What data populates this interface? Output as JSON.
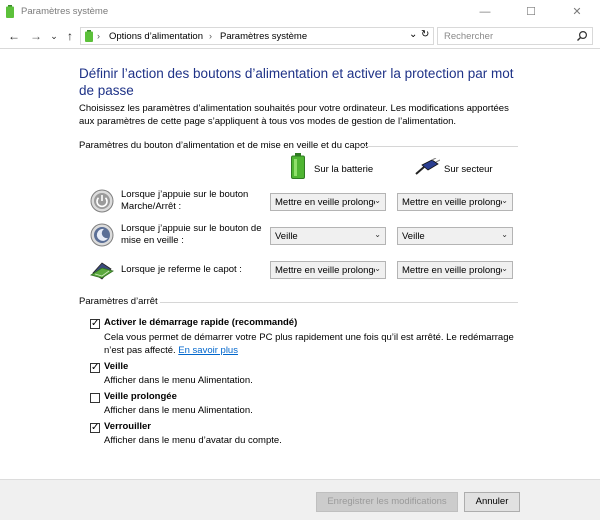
{
  "window": {
    "title": "Paramètres système",
    "minimize": "—",
    "maximize": "☐",
    "close": "✕"
  },
  "nav": {
    "back": "←",
    "forward": "→",
    "dropdown": "⌄",
    "up": "↑",
    "breadcrumbs": [
      "Options d’alimentation",
      "Paramètres système"
    ],
    "breadcrumb_sep": "›",
    "address_dropdown": "⌄",
    "refresh": "↻"
  },
  "search": {
    "placeholder": "Rechercher"
  },
  "page": {
    "heading": "Définir l’action des boutons d’alimentation et activer la protection par mot de passe",
    "intro": "Choisissez les paramètres d’alimentation souhaités pour votre ordinateur. Les modifications apportées aux paramètres de cette page s’appliquent à tous vos modes de gestion de l’alimentation."
  },
  "power_buttons": {
    "group_label": "Paramètres du bouton d’alimentation et de mise en veille et du capot",
    "col_battery": "Sur la batterie",
    "col_plugged": "Sur secteur",
    "rows": [
      {
        "label": "Lorsque j’appuie sur le bouton Marche/Arrêt :",
        "battery": "Mettre en veille prolongée",
        "plugged": "Mettre en veille prolongée"
      },
      {
        "label": "Lorsque j’appuie sur le bouton de mise en veille :",
        "battery": "Veille",
        "plugged": "Veille"
      },
      {
        "label": "Lorsque je referme le capot :",
        "battery": "Mettre en veille prolongée",
        "plugged": "Mettre en veille prolongée"
      }
    ]
  },
  "shutdown": {
    "group_label": "Paramètres d’arrêt",
    "options": [
      {
        "title": "Activer le démarrage rapide (recommandé)",
        "desc": "Cela vous permet de démarrer votre PC plus rapidement une fois qu’il est arrêté. Le redémarrage n’est pas affecté.",
        "link": "En savoir plus",
        "checked": true
      },
      {
        "title": "Veille",
        "desc": "Afficher dans le menu Alimentation.",
        "checked": true
      },
      {
        "title": "Veille prolongée",
        "desc": "Afficher dans le menu Alimentation.",
        "checked": false
      },
      {
        "title": "Verrouiller",
        "desc": "Afficher dans le menu d’avatar du compte.",
        "checked": true
      }
    ]
  },
  "footer": {
    "save": "Enregistrer les modifications",
    "cancel": "Annuler"
  },
  "icons": {
    "checkmark": "✓",
    "select_arrow": "⌄"
  }
}
